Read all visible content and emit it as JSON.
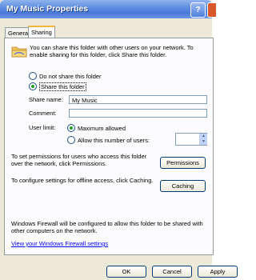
{
  "window": {
    "title": "My Music Properties"
  },
  "tabs": [
    {
      "label": "General"
    },
    {
      "label": "Sharing"
    }
  ],
  "sharing": {
    "description": "You can share this folder with other users on your network. To enable sharing for this folder, click Share this folder.",
    "radio_dont_share": "Do not share this folder",
    "radio_share": "Share this folder",
    "share_name_label": "Share name:",
    "share_name_value": "My Music",
    "comment_label": "Comment:",
    "comment_value": "",
    "user_limit_label": "User limit:",
    "radio_max_allowed": "Maximum allowed",
    "radio_allow_number": "Allow this number of users:",
    "permissions_text": "To set permissions for users who access this folder over the network, click Permissions.",
    "permissions_button": "Permissions",
    "caching_text": "To configure settings for offline access, click Caching.",
    "caching_button": "Caching",
    "firewall_text": "Windows Firewall will be configured to allow this folder to be shared with other computers on the network.",
    "firewall_link": "View your Windows Firewall settings"
  },
  "buttons": {
    "ok": "OK",
    "cancel": "Cancel",
    "apply": "Apply"
  },
  "colors": {
    "title_bar": "#4a78d6",
    "dialog_bg": "#ece9d8",
    "tab_highlight": "#f7b53c"
  }
}
